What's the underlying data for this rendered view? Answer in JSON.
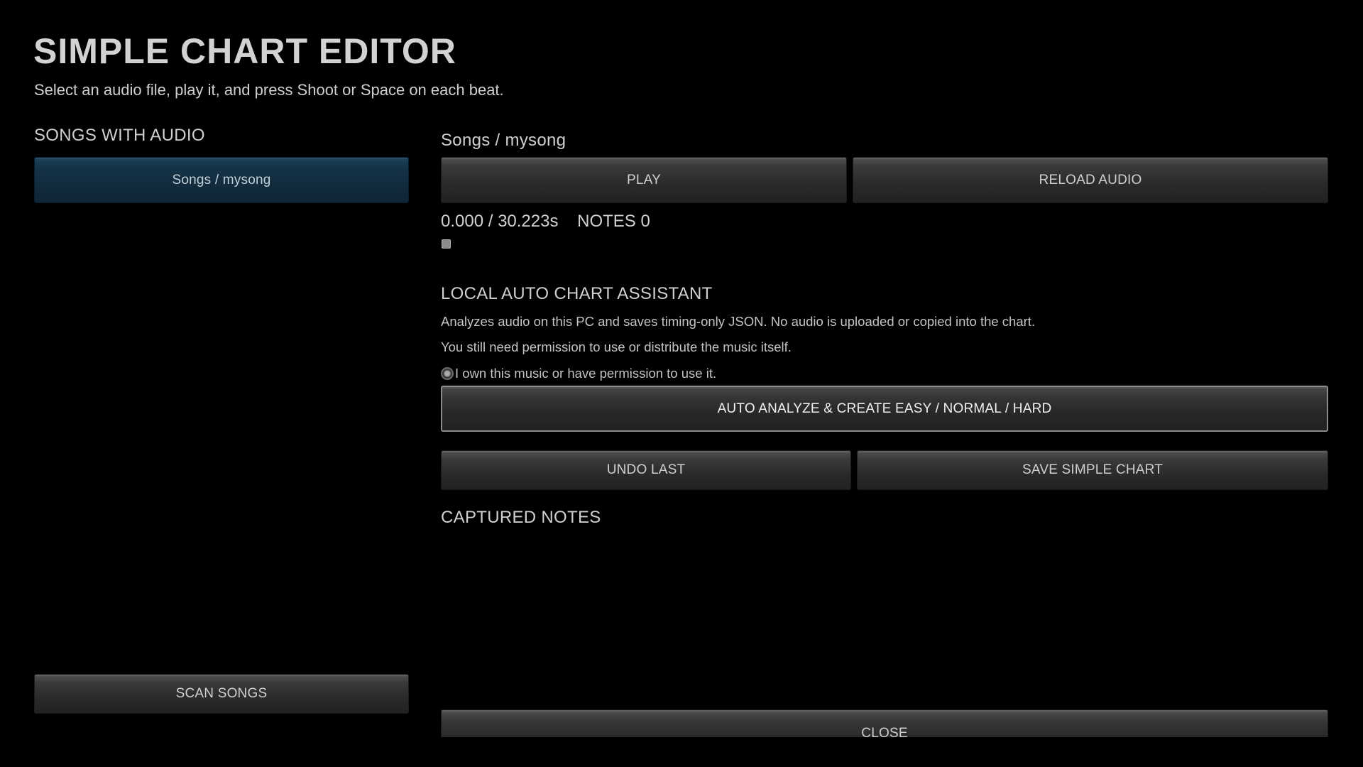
{
  "header": {
    "title": "SIMPLE CHART EDITOR",
    "subtitle": "Select an audio file, play it, and press Shoot or Space on each beat."
  },
  "sidebar": {
    "heading": "SONGS WITH AUDIO",
    "songs": [
      {
        "label": "Songs / mysong",
        "selected": true
      }
    ],
    "scan_label": "SCAN SONGS"
  },
  "editor": {
    "current_song": "Songs / mysong",
    "play_label": "PLAY",
    "reload_label": "RELOAD AUDIO",
    "time_current": "0.000",
    "time_total": "30.223s",
    "time_display": "0.000 / 30.223s",
    "notes_label": "NOTES",
    "notes_count": "0",
    "notes_display": "NOTES 0",
    "progress": 0
  },
  "assistant": {
    "heading": "LOCAL AUTO CHART ASSISTANT",
    "line1": "Analyzes audio on this PC and saves timing-only JSON. No audio is uploaded or copied into the chart.",
    "line2": "You still need permission to use or distribute the music itself.",
    "consent_label": "I own this music or have permission to use it.",
    "analyze_label": "AUTO ANALYZE & CREATE EASY / NORMAL / HARD"
  },
  "actions": {
    "undo_label": "UNDO LAST",
    "save_label": "SAVE SIMPLE CHART"
  },
  "captured": {
    "heading": "CAPTURED NOTES",
    "notes": []
  },
  "footer": {
    "close_label": "CLOSE"
  },
  "colors": {
    "background": "#000000",
    "selected_song": "#143246",
    "button": "#2e2e2e",
    "text": "#c8c8c8"
  }
}
